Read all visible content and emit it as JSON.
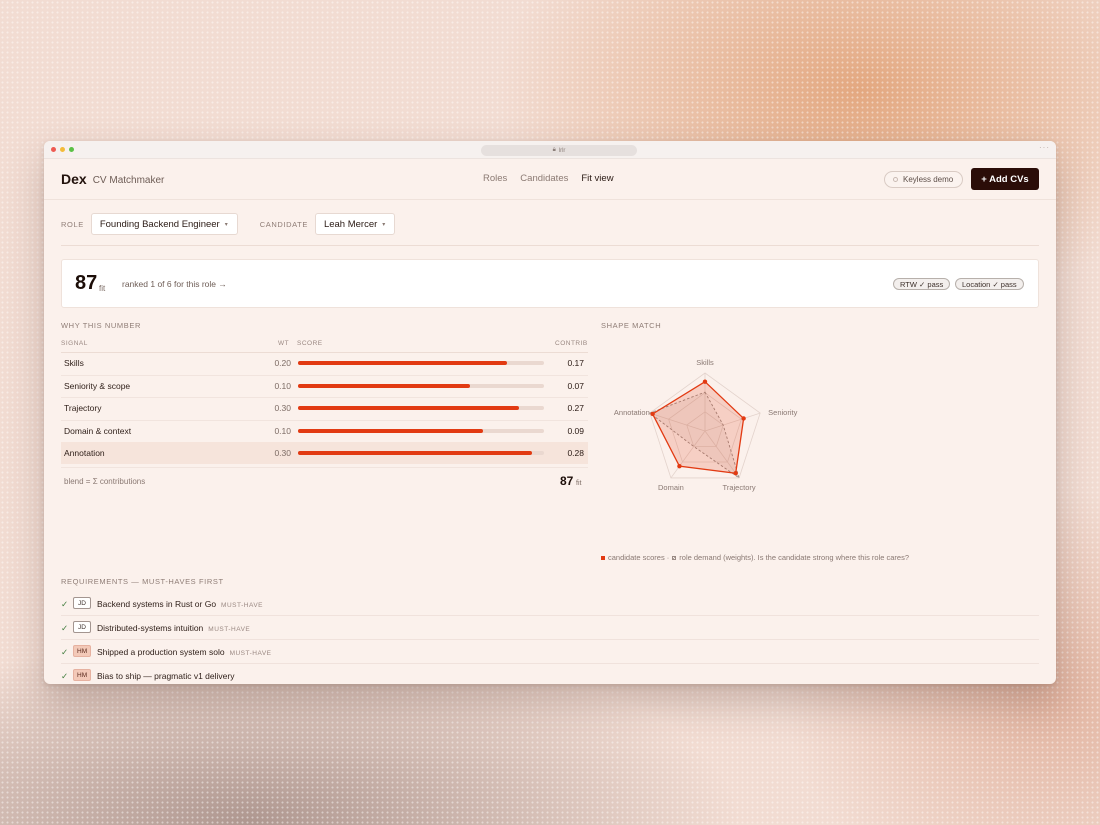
{
  "browser": {
    "url": "lrlr"
  },
  "app": {
    "brand": "Dex",
    "subtitle": "CV Matchmaker"
  },
  "nav": {
    "roles": "Roles",
    "candidates": "Candidates",
    "fit_view": "Fit view"
  },
  "header": {
    "keyless": "Keyless demo",
    "add_cvs": "+ Add CVs"
  },
  "filters": {
    "role_label": "ROLE",
    "role_value": "Founding Backend Engineer",
    "candidate_label": "CANDIDATE",
    "candidate_value": "Leah Mercer"
  },
  "summary": {
    "score": "87",
    "unit": "fit",
    "ranked": "ranked 1 of 6 for this role →",
    "chips": [
      "RTW ✓ pass",
      "Location ✓ pass"
    ]
  },
  "breakdown": {
    "title": "WHY THIS NUMBER",
    "columns": {
      "signal": "SIGNAL",
      "wt": "WT",
      "score": "SCORE",
      "contrib": "CONTRIB"
    },
    "rows": [
      {
        "signal": "Skills",
        "wt": "0.20",
        "score": 0.85,
        "contrib": "0.17"
      },
      {
        "signal": "Seniority & scope",
        "wt": "0.10",
        "score": 0.7,
        "contrib": "0.07"
      },
      {
        "signal": "Trajectory",
        "wt": "0.30",
        "score": 0.9,
        "contrib": "0.27"
      },
      {
        "signal": "Domain & context",
        "wt": "0.10",
        "score": 0.75,
        "contrib": "0.09"
      },
      {
        "signal": "Annotation",
        "wt": "0.30",
        "score": 0.95,
        "contrib": "0.28"
      }
    ],
    "blend_label": "blend = Σ contributions",
    "blend_value": "87",
    "blend_unit": "fit"
  },
  "shape": {
    "title": "SHAPE MATCH",
    "axes": [
      "Skills",
      "Seniority",
      "Trajectory",
      "Domain",
      "Annotation"
    ],
    "candidate": [
      0.85,
      0.7,
      0.9,
      0.75,
      0.95
    ],
    "role_demand": [
      0.67,
      0.33,
      1.0,
      0.33,
      1.0
    ],
    "colors": {
      "candidate": "#e23a12",
      "demand": "#9a8a84"
    },
    "caption_a": "candidate scores ·",
    "caption_b": "role demand (weights). Is the candidate strong where this role cares?"
  },
  "requirements": {
    "title": "REQUIREMENTS — MUST-HAVES FIRST",
    "items": [
      {
        "check": "✓",
        "tag": "JD",
        "text": "Backend systems in Rust or Go",
        "flag": "MUST-HAVE"
      },
      {
        "check": "✓",
        "tag": "JD",
        "text": "Distributed-systems intuition",
        "flag": "MUST-HAVE"
      },
      {
        "check": "✓",
        "tag": "HM",
        "text": "Shipped a production system solo",
        "flag": "MUST-HAVE"
      },
      {
        "check": "✓",
        "tag": "HM",
        "text": "Bias to ship — pragmatic v1 delivery",
        "flag": ""
      }
    ]
  }
}
